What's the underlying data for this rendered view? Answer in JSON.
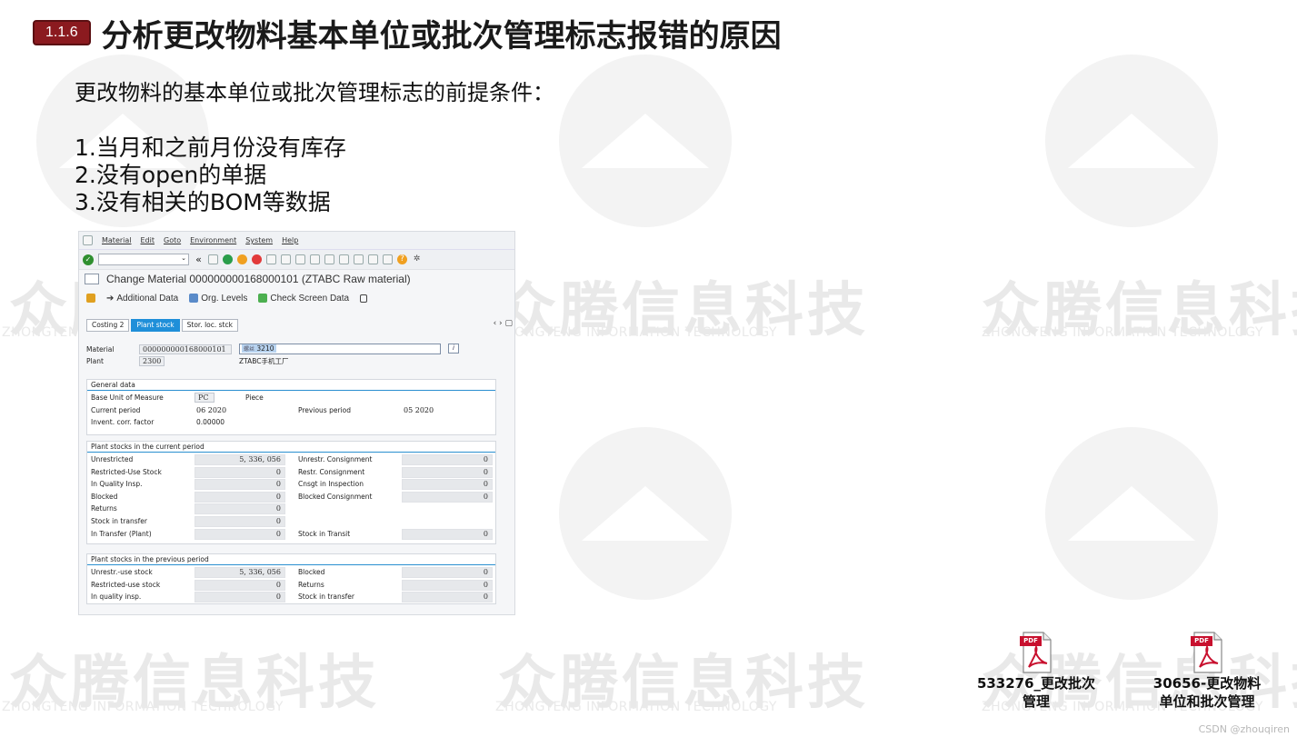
{
  "watermark": {
    "brand_cn": "众腾信息科技",
    "brand_en": "ZHONGTENG INFORMATION TECHNOLOGY"
  },
  "slide": {
    "badge": "1.1.6",
    "title": "分析更改物料基本单位或批次管理标志报错的原因",
    "lead": "更改物料的基本单位或批次管理标志的前提条件：",
    "conditions": [
      "1.当月和之前月份没有库存",
      "2.没有open的单据",
      "3.没有相关的BOM等数据"
    ]
  },
  "sap": {
    "menu": [
      "Material",
      "Edit",
      "Goto",
      "Environment",
      "System",
      "Help"
    ],
    "window_title": "Change Material 000000000168000101 (ZTABC Raw material)",
    "app_toolbar": {
      "additional_data": "Additional Data",
      "org_levels": "Org. Levels",
      "check_screen_data": "Check Screen Data"
    },
    "tabs": [
      {
        "label": "Costing 2",
        "active": false
      },
      {
        "label": "Plant stock",
        "active": true
      },
      {
        "label": "Stor. loc. stck",
        "active": false
      }
    ],
    "header": {
      "material_label": "Material",
      "material_value": "000000000168000101",
      "material_desc": "3210",
      "material_desc_prefix": "螺丝",
      "plant_label": "Plant",
      "plant_value": "2300",
      "plant_desc": "ZTABC手机工厂"
    },
    "general": {
      "title": "General data",
      "base_uom_label": "Base Unit of Measure",
      "base_uom_value": "PC",
      "base_uom_text": "Piece",
      "current_period_label": "Current period",
      "current_period_value": "06  2020",
      "previous_period_label": "Previous period",
      "previous_period_value": "05  2020",
      "invent_factor_label": "Invent. corr. factor",
      "invent_factor_value": "0.00000"
    },
    "current_stocks": {
      "title": "Plant stocks in the current period",
      "left": [
        {
          "label": "Unrestricted",
          "value": "5, 336, 056"
        },
        {
          "label": "Restricted-Use Stock",
          "value": "0"
        },
        {
          "label": "In Quality Insp.",
          "value": "0"
        },
        {
          "label": "Blocked",
          "value": "0"
        },
        {
          "label": "Returns",
          "value": "0"
        },
        {
          "label": "Stock in transfer",
          "value": "0"
        },
        {
          "label": "In Transfer (Plant)",
          "value": "0"
        }
      ],
      "right": [
        {
          "label": "Unrestr. Consignment",
          "value": "0"
        },
        {
          "label": "Restr. Consignment",
          "value": "0"
        },
        {
          "label": "Cnsgt in Inspection",
          "value": "0"
        },
        {
          "label": "Blocked Consignment",
          "value": "0"
        }
      ],
      "transit_label": "Stock in Transit",
      "transit_value": "0"
    },
    "previous_stocks": {
      "title": "Plant stocks in the previous period",
      "left": [
        {
          "label": "Unrestr.-use stock",
          "value": "5, 336, 056"
        },
        {
          "label": "Restricted-use stock",
          "value": "0"
        },
        {
          "label": "In quality insp.",
          "value": "0"
        }
      ],
      "right": [
        {
          "label": "Blocked",
          "value": "0"
        },
        {
          "label": "Returns",
          "value": "0"
        },
        {
          "label": "Stock in transfer",
          "value": "0"
        }
      ]
    }
  },
  "attachments": [
    {
      "badge": "PDF",
      "line1": "533276_更改批次",
      "line2": "管理"
    },
    {
      "badge": "PDF",
      "line1": "30656-更改物料",
      "line2": "单位和批次管理"
    }
  ],
  "footer": {
    "csdn": "CSDN @zhouqiren"
  }
}
